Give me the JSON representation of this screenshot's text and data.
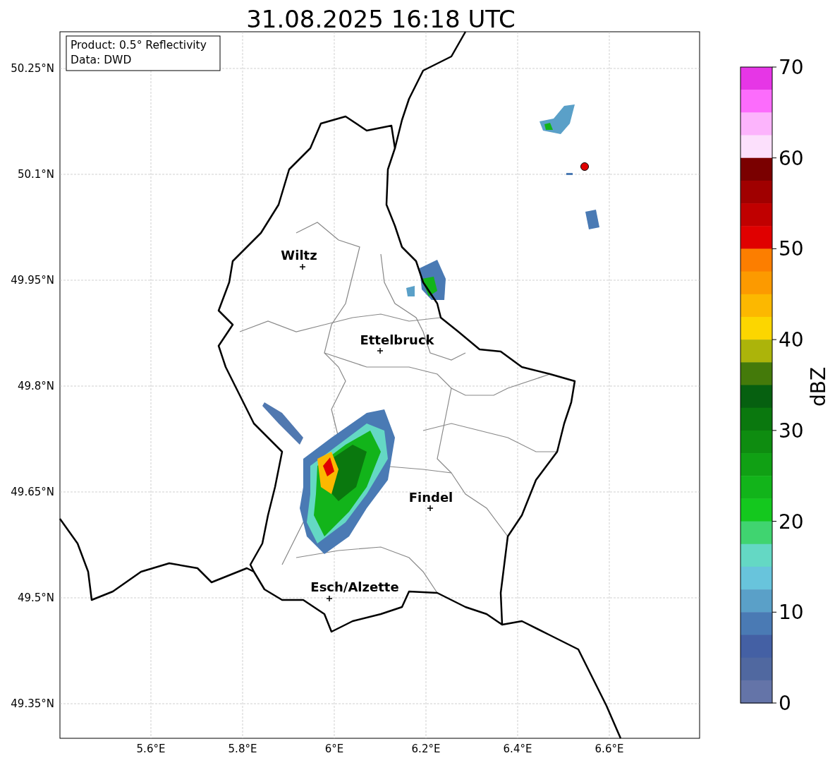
{
  "title": "31.08.2025 16:18 UTC",
  "info_box": [
    "Product: 0.5° Reflectivity",
    "Data: DWD"
  ],
  "y_ticks": [
    "50.25°N",
    "50.1°N",
    "49.95°N",
    "49.8°N",
    "49.65°N",
    "49.5°N",
    "49.35°N"
  ],
  "x_ticks": [
    "5.6°E",
    "5.8°E",
    "6°E",
    "6.2°E",
    "6.4°E",
    "6.6°E"
  ],
  "cities": [
    {
      "name": "Wiltz"
    },
    {
      "name": "Ettelbruck"
    },
    {
      "name": "Findel"
    },
    {
      "name": "Esch/Alzette"
    }
  ],
  "colorbar": {
    "label": "dBZ",
    "ticks": [
      "70",
      "60",
      "50",
      "40",
      "30",
      "20",
      "10",
      "0"
    ],
    "bands": [
      {
        "color": "#e636e6"
      },
      {
        "color": "#fc6cfc"
      },
      {
        "color": "#fcb4fc"
      },
      {
        "color": "#fce0fc"
      },
      {
        "color": "#7a0000"
      },
      {
        "color": "#a00000"
      },
      {
        "color": "#c00000"
      },
      {
        "color": "#e00000"
      },
      {
        "color": "#fc7e00"
      },
      {
        "color": "#fc9a00"
      },
      {
        "color": "#fcb800"
      },
      {
        "color": "#fcd600"
      },
      {
        "color": "#acb40a"
      },
      {
        "color": "#447a0a"
      },
      {
        "color": "#066010"
      },
      {
        "color": "#0a780e"
      },
      {
        "color": "#0e8c10"
      },
      {
        "color": "#10a014"
      },
      {
        "color": "#12b41a"
      },
      {
        "color": "#14c81e"
      },
      {
        "color": "#40d470"
      },
      {
        "color": "#64d8c4"
      },
      {
        "color": "#68c4dc"
      },
      {
        "color": "#5aa0c8"
      },
      {
        "color": "#4a7ab4"
      },
      {
        "color": "#4460a4"
      },
      {
        "color": "#5068a0"
      },
      {
        "color": "#6474a8"
      }
    ]
  }
}
